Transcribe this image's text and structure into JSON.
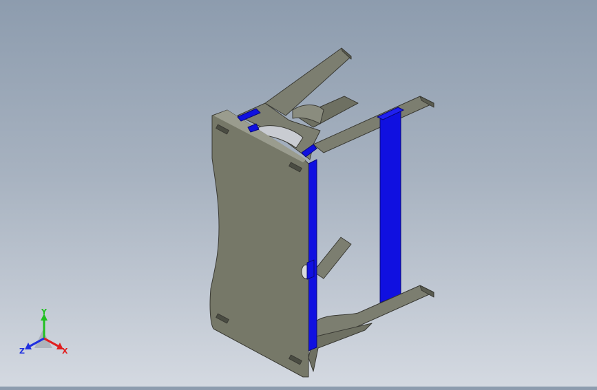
{
  "viewport": {
    "background_top": "#8d9cae",
    "background_bottom": "#d4d9e1",
    "part_color": "#767868",
    "part_edge": "#3a3a34",
    "highlight_color": "#1010e0"
  },
  "triad": {
    "x_label": "X",
    "y_label": "Y",
    "z_label": "Z",
    "x_color": "#e02020",
    "y_color": "#20c020",
    "z_color": "#2030e0"
  }
}
